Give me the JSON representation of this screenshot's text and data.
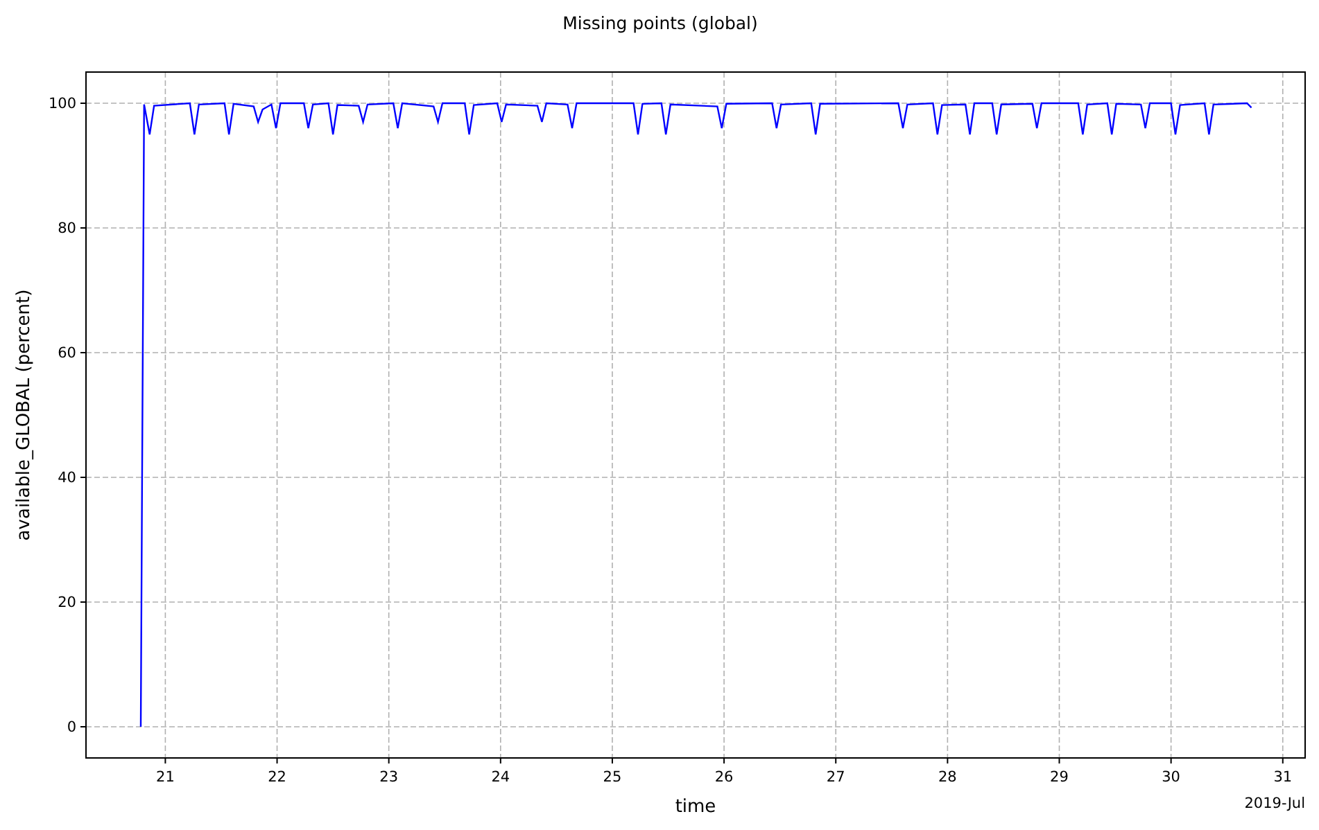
{
  "figure": {
    "chart_data": {
      "type": "line",
      "title": "Missing points (global)",
      "xlabel": "time",
      "ylabel": "available_GLOBAL (percent)",
      "x": [
        20.78,
        20.81,
        20.86,
        20.9,
        21.22,
        21.26,
        21.3,
        21.53,
        21.57,
        21.61,
        21.79,
        21.83,
        21.87,
        21.95,
        21.99,
        22.03,
        22.24,
        22.28,
        22.32,
        22.46,
        22.5,
        22.54,
        22.73,
        22.77,
        22.81,
        23.04,
        23.08,
        23.12,
        23.4,
        23.44,
        23.48,
        23.68,
        23.72,
        23.76,
        23.97,
        24.01,
        24.05,
        24.33,
        24.37,
        24.41,
        24.6,
        24.64,
        24.68,
        25.19,
        25.23,
        25.27,
        25.44,
        25.48,
        25.52,
        25.94,
        25.98,
        26.02,
        26.43,
        26.47,
        26.51,
        26.78,
        26.82,
        26.86,
        27.56,
        27.6,
        27.64,
        27.87,
        27.91,
        27.95,
        28.16,
        28.2,
        28.24,
        28.4,
        28.44,
        28.48,
        28.76,
        28.8,
        28.84,
        29.17,
        29.21,
        29.25,
        29.43,
        29.47,
        29.51,
        29.73,
        29.77,
        29.81,
        30.0,
        30.04,
        30.08,
        30.3,
        30.34,
        30.38,
        30.68,
        30.72
      ],
      "grid": true,
      "series": [
        {
          "color": "#0000ff",
          "values": [
            0,
            99.8,
            95,
            99.6,
            100,
            95,
            99.8,
            100,
            95,
            99.9,
            99.5,
            97,
            99,
            99.8,
            96,
            100,
            100,
            96,
            99.8,
            100,
            95,
            99.7,
            99.6,
            97,
            99.8,
            100,
            96,
            100,
            99.5,
            97,
            100,
            100,
            95,
            99.7,
            100,
            97,
            99.8,
            99.6,
            97,
            100,
            99.8,
            96,
            100,
            100,
            95,
            99.9,
            100,
            95,
            99.8,
            99.5,
            96,
            99.9,
            100,
            96,
            99.8,
            100,
            95,
            99.9,
            100,
            96,
            99.8,
            100,
            95,
            99.7,
            99.8,
            95,
            100,
            100,
            95,
            99.8,
            99.9,
            96,
            100,
            100,
            95,
            99.8,
            100,
            95,
            99.9,
            99.8,
            96,
            100,
            100,
            95,
            99.7,
            100,
            95,
            99.8,
            100,
            99.3
          ]
        }
      ],
      "xlim": [
        20.29,
        31.2
      ],
      "ylim": [
        -5,
        105
      ],
      "xticks": [
        21,
        22,
        23,
        24,
        25,
        26,
        27,
        28,
        29,
        30,
        31
      ],
      "yticks": [
        0,
        20,
        40,
        60,
        80,
        100
      ],
      "annotations": [
        {
          "text": "2019-Jul"
        }
      ]
    }
  }
}
